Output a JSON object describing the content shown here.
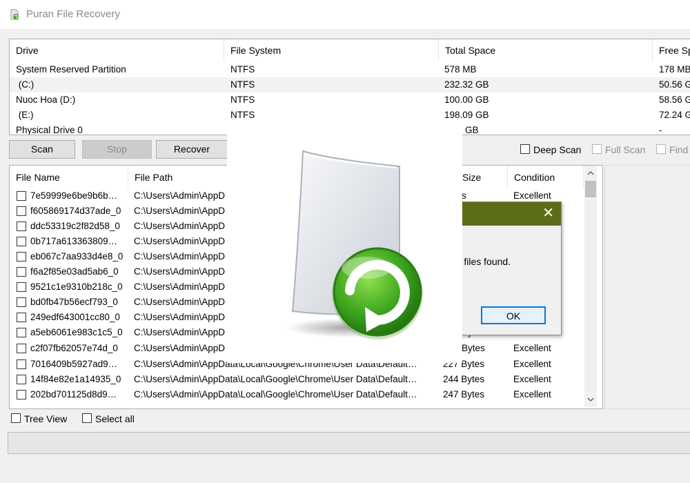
{
  "app": {
    "title": "Puran File Recovery"
  },
  "drives": {
    "headers": {
      "drive": "Drive",
      "filesystem": "File System",
      "total": "Total Space",
      "free": "Free Sp"
    },
    "rows": [
      {
        "drive": "System Reserved Partition",
        "fs": "NTFS",
        "total": "578 MB",
        "free": "178 MB"
      },
      {
        "drive": " (C:)",
        "fs": "NTFS",
        "total": "232.32 GB",
        "free": "50.56 G"
      },
      {
        "drive": "Nuoc Hoa (D:)",
        "fs": "NTFS",
        "total": "100.00 GB",
        "free": "58.56 G"
      },
      {
        "drive": " (E:)",
        "fs": "NTFS",
        "total": "198.09 GB",
        "free": "72.24 G"
      },
      {
        "drive": "Physical Drive 0",
        "fs": "",
        "total": "...89 GB",
        "free": "-"
      }
    ]
  },
  "toolbar": {
    "scan": "Scan",
    "stop": "Stop",
    "recover": "Recover",
    "deep_scan": "Deep Scan",
    "full_scan": "Full Scan",
    "find": "Find"
  },
  "files": {
    "headers": {
      "name": "File Name",
      "path": "File Path",
      "size": "Size",
      "condition": "Condition"
    },
    "rows": [
      {
        "name": "7e59999e6be9b6b…",
        "path": "C:\\Users\\Admin\\AppD",
        "size": "Bytes",
        "cond": "Excellent"
      },
      {
        "name": "f605869174d37ade_0",
        "path": "C:\\Users\\Admin\\AppD",
        "size": "",
        "cond": ""
      },
      {
        "name": "ddc53319c2f82d58_0",
        "path": "C:\\Users\\Admin\\AppD",
        "size": "",
        "cond": ""
      },
      {
        "name": "0b717a613363809…",
        "path": "C:\\Users\\Admin\\AppD",
        "size": "",
        "cond": ""
      },
      {
        "name": "eb067c7aa933d4e8_0",
        "path": "C:\\Users\\Admin\\AppD",
        "size": "",
        "cond": ""
      },
      {
        "name": "f6a2f85e03ad5ab6_0",
        "path": "C:\\Users\\Admin\\AppD",
        "size": "",
        "cond": ""
      },
      {
        "name": "9521c1e9310b218c_0",
        "path": "C:\\Users\\Admin\\AppD",
        "size": "",
        "cond": ""
      },
      {
        "name": "bd0fb47b56ecf793_0",
        "path": "C:\\Users\\Admin\\AppD",
        "size": "",
        "cond": ""
      },
      {
        "name": "249edf643001cc80_0",
        "path": "C:\\Users\\Admin\\AppD",
        "size": "",
        "cond": ""
      },
      {
        "name": "a5eb6061e983c1c5_0",
        "path": "C:\\Users\\Admin\\AppD",
        "size": "Bytes",
        "cond": "Excellent"
      },
      {
        "name": "c2f07fb62057e74d_0",
        "path": "C:\\Users\\Admin\\AppD",
        "size": "Bytes",
        "cond": "Excellent"
      },
      {
        "name": "7016409b5927ad9…",
        "path": "C:\\Users\\Admin\\AppData\\Local\\Google\\Chrome\\User Data\\Default…",
        "size": "227 Bytes",
        "cond": "Excellent"
      },
      {
        "name": "14f84e82e1a14935_0",
        "path": "C:\\Users\\Admin\\AppData\\Local\\Google\\Chrome\\User Data\\Default…",
        "size": "244 Bytes",
        "cond": "Excellent"
      },
      {
        "name": "202bd701125d8d9…",
        "path": "C:\\Users\\Admin\\AppData\\Local\\Google\\Chrome\\User Data\\Default…",
        "size": "247 Bytes",
        "cond": "Excellent"
      }
    ]
  },
  "bottom": {
    "tree_view": "Tree View",
    "select_all": "Select all"
  },
  "dialog": {
    "message": "ted files found.",
    "ok": "OK",
    "close": "✕"
  },
  "icons": {
    "app": "recovery-icon",
    "close": "close-icon",
    "scroll_up": "chevron-up-icon",
    "scroll_down": "chevron-down-icon",
    "logo": "file-recovery-logo"
  },
  "colors": {
    "dialog_title": "#5b6d16",
    "ok_border": "#0078d7",
    "logo_green": "#3aa31c"
  }
}
